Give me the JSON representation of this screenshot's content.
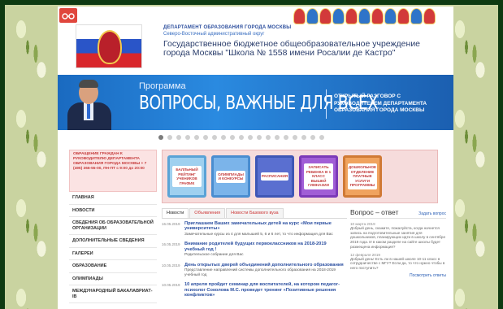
{
  "header": {
    "department": "ДЕПАРТАМЕНТ ОБРАЗОВАНИЯ ГОРОДА МОСКВЫ",
    "district": "Северо-Восточный административный округ",
    "school_name": "Государственное бюджетное общеобразовательное учреждение города Москвы \"Школа № 1558 имени Росалии де Кастро\"",
    "badges": [
      {
        "icon": "award-badge-icon",
        "color": "#d23a3a"
      },
      {
        "icon": "award-badge-icon",
        "color": "#2f74c9"
      },
      {
        "icon": "award-badge-icon",
        "color": "#d23a3a"
      },
      {
        "icon": "award-badge-icon",
        "color": "#2f74c9"
      },
      {
        "icon": "award-badge-icon",
        "color": "#d23a3a"
      },
      {
        "icon": "award-badge-icon",
        "color": "#2f74c9"
      },
      {
        "icon": "award-badge-icon",
        "color": "#d23a3a"
      },
      {
        "icon": "award-badge-icon",
        "color": "#2f74c9"
      },
      {
        "icon": "award-badge-icon",
        "color": "#d23a3a"
      },
      {
        "icon": "award-badge-icon",
        "color": "#2f74c9"
      },
      {
        "icon": "award-badge-icon",
        "color": "#d23a3a"
      }
    ]
  },
  "banner": {
    "program_label": "Программа",
    "program_title": "ВОПРОСЫ, ВАЖНЫЕ ДЛЯ ВСЕХ",
    "right_text": "ОТКРЫТЫЙ РАЗГОВОР С РУКОВОДИТЕЛЕМ ДЕПАРТАМЕНТА ОБРАЗОВАНИЯ ГОРОДА МОСКВЫ"
  },
  "slider": {
    "dot_count": 19,
    "active_index": 0
  },
  "help_box": {
    "text": "ОБРАЩЕНИЕ ГРАЖДАН К РУКОВОДИТЕЛЮ ДЕПАРТАМЕНТА ОБРАЗОВАНИЯ ГОРОДА МОСКВЫ + 7 (495) 366-55-00, ПН-ПТ с 9:00 до 20:00"
  },
  "menu": [
    "ГЛАВНАЯ",
    "НОВОСТИ",
    "СВЕДЕНИЯ ОБ ОБРАЗОВАТЕЛЬНОЙ ОРГАНИЗАЦИИ",
    "ДОПОЛНИТЕЛЬНЫЕ СВЕДЕНИЯ",
    "ГАЛЕРЕИ",
    "ОБРАЗОВАНИЕ",
    "ОЛИМПИАДЫ",
    "МЕЖДУНАРОДНЫЙ БАКАЛАВРИАТ-IB"
  ],
  "tiles": [
    {
      "label": "БАЛЛЬНЫЙ РЕЙТИНГ УЧЕНИКОВ ГРАФИК",
      "border": "#5aa3d6",
      "bg": "#9fd0ef",
      "color": "#c23a3a"
    },
    {
      "label": "ОЛИМПИАДЫ И КОНКУРСЫ",
      "border": "#4a8dd0",
      "bg": "#7bb4ea",
      "color": "#c23a3a"
    },
    {
      "label": "РАСПИСАНИЯ",
      "border": "#3e56b5",
      "bg": "#5a6fd0",
      "color": "#c23a3a"
    },
    {
      "label": "ЗАПИСАТЬ РЕБЕНКА В 1 КЛАСС ВЫШЕЙ ГИМНАЗИИ",
      "border": "#7c3ab8",
      "bg": "#a15ed6",
      "color": "#c23a3a"
    },
    {
      "label": "ДОШКОЛЬНОЕ ОТДЕЛЕНИЕ ПЛАТНЫЕ УСЛУГИ ПРОГРАММЫ",
      "border": "#d07a36",
      "bg": "#f0a35f",
      "color": "#c23a3a"
    }
  ],
  "news_tabs": [
    "Новости",
    "Объявления",
    "Новости Базового вуза"
  ],
  "news": [
    {
      "date": "16.05.2019",
      "title": "Приглашаем Ваших замечательных детей на курс «Мои первые университеты»",
      "desc": "Замечательные курсы из 4 для малышей 5, 6 и 6 лет, то что информация для Вас"
    },
    {
      "date": "16.05.2019",
      "title": "Внимание родителей будущих первоклассников на 2018-2019 учебный год !",
      "desc": "Родительское собрание для Вас"
    },
    {
      "date": "10.05.2019",
      "title": "День открытых дверей объединений дополнительного образования",
      "desc": "Представление направлений системы дополнительного образования на 2018-2019 учебный год"
    },
    {
      "date": "10.05.2019",
      "title": "10 апреля пройдет семинар для воспитателей, на котором педагог-психолог Соколова М.С. проведет тренинг «Позитивные решения конфликтов»",
      "desc": ""
    }
  ],
  "qa": {
    "title": "Вопрос – ответ",
    "ask_label": "Задать вопрос",
    "items": [
      {
        "date": "10 марта 2019",
        "text": "Добрый день, скажите, пожалуйста, когда начнется запись на подготовительные занятия для дошкольников, планирующих идти в школу в сентябре 2019 года. И в каком разделе на сайте школы будет размещена информация?"
      },
      {
        "date": "12 февраля 2019",
        "text": "Добрый день! Есть ли в нашей школе 10-11 класс в сотрудничестве с МГУ? Если да, то что нужно чтобы в него поступить?"
      }
    ],
    "more_label": "Посмотреть ответы"
  }
}
